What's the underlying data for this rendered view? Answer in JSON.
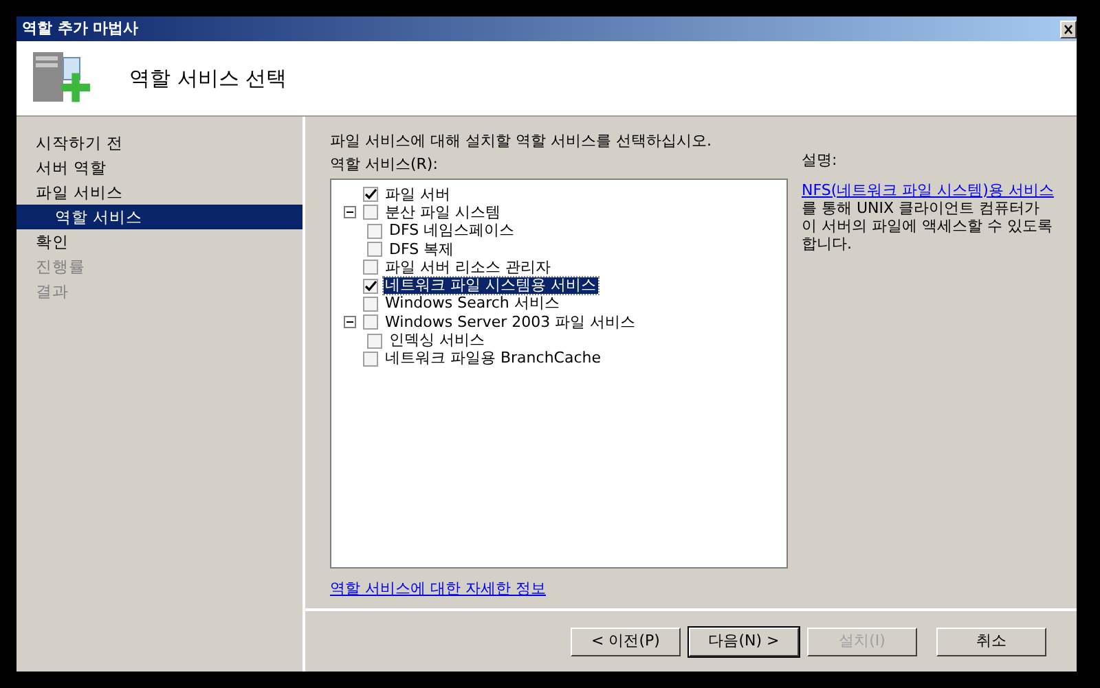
{
  "window": {
    "title": "역할 추가 마법사"
  },
  "header": {
    "title": "역할 서비스 선택"
  },
  "sidebar": {
    "items": [
      {
        "label": "시작하기 전",
        "selected": false,
        "disabled": false,
        "indented": false
      },
      {
        "label": "서버 역할",
        "selected": false,
        "disabled": false,
        "indented": false
      },
      {
        "label": "파일 서비스",
        "selected": false,
        "disabled": false,
        "indented": false
      },
      {
        "label": "역할 서비스",
        "selected": true,
        "disabled": false,
        "indented": true
      },
      {
        "label": "확인",
        "selected": false,
        "disabled": false,
        "indented": false
      },
      {
        "label": "진행률",
        "selected": false,
        "disabled": true,
        "indented": false
      },
      {
        "label": "결과",
        "selected": false,
        "disabled": true,
        "indented": false
      }
    ]
  },
  "instruction": "파일 서비스에 대해 설치할 역할 서비스를 선택하십시오.",
  "tree_label": "역할 서비스(R):",
  "tree": [
    {
      "label": "파일 서버",
      "checked": true,
      "selected": false
    },
    {
      "label": "분산 파일 시스템",
      "checked": false,
      "selected": false,
      "expanded": true,
      "children": [
        {
          "label": "DFS 네임스페이스",
          "checked": false,
          "selected": false
        },
        {
          "label": "DFS 복제",
          "checked": false,
          "selected": false
        }
      ]
    },
    {
      "label": "파일 서버 리소스 관리자",
      "checked": false,
      "selected": false
    },
    {
      "label": "네트워크 파일 시스템용 서비스",
      "checked": true,
      "selected": true
    },
    {
      "label": "Windows Search 서비스",
      "checked": false,
      "selected": false
    },
    {
      "label": "Windows Server 2003 파일 서비스",
      "checked": false,
      "selected": false,
      "expanded": true,
      "children": [
        {
          "label": "인덱싱 서비스",
          "checked": false,
          "selected": false
        }
      ]
    },
    {
      "label": "네트워크 파일용 BranchCache",
      "checked": false,
      "selected": false
    }
  ],
  "description": {
    "heading": "설명:",
    "link": "NFS(네트워크 파일 시스템)용 서비스",
    "text": "를 통해 UNIX 클라이언트 컴퓨터가 이 서버의 파일에 액세스할 수 있도록 합니다."
  },
  "more_info_link": "역할 서비스에 대한 자세한 정보",
  "buttons": [
    {
      "label": "< 이전(P)",
      "disabled": false,
      "default": false
    },
    {
      "label": "다음(N) >",
      "disabled": false,
      "default": true
    },
    {
      "label": "설치(I)",
      "disabled": true,
      "default": false
    },
    {
      "label": "취소",
      "disabled": false,
      "default": false
    }
  ]
}
